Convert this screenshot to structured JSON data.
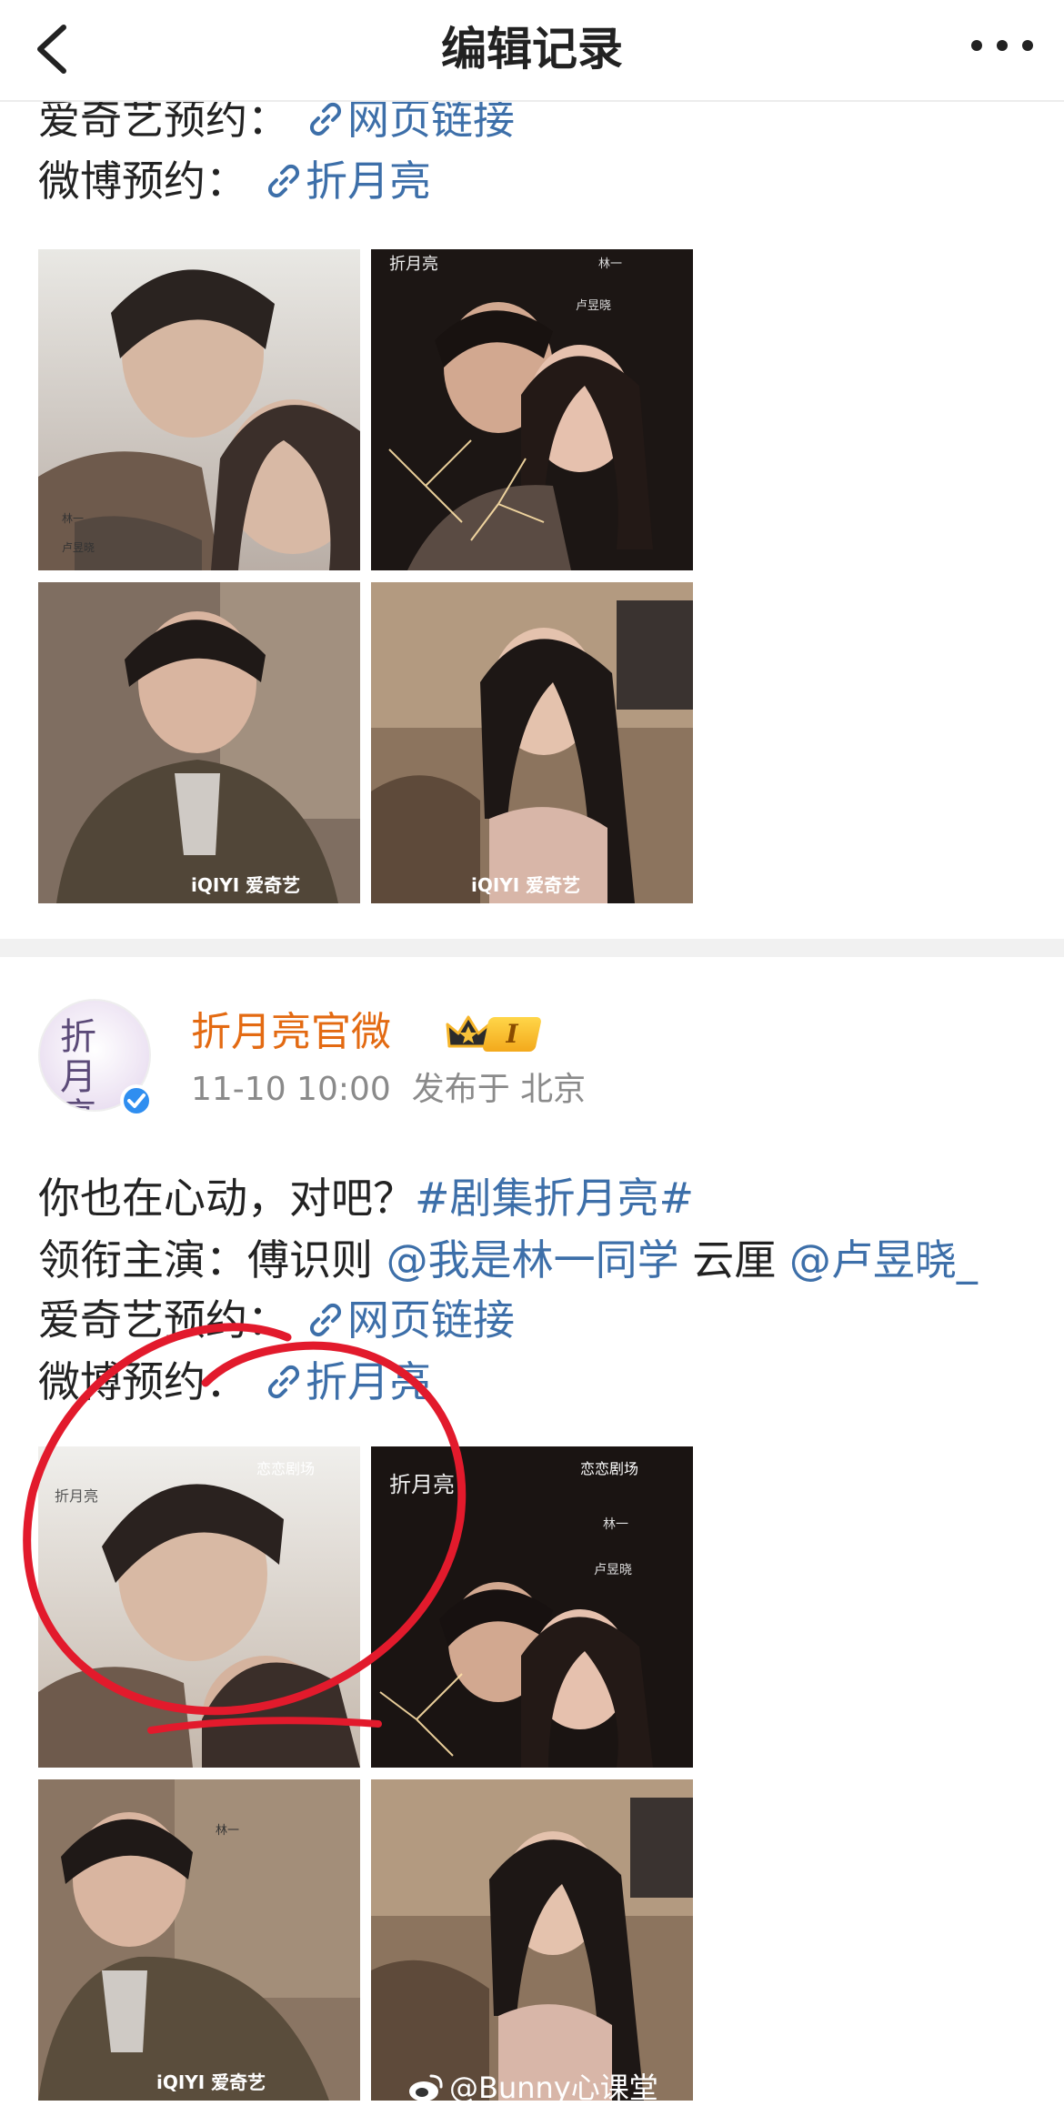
{
  "nav": {
    "title": "编辑记录",
    "back_icon": "chevron-left-icon",
    "more_icon": "more-dots-icon"
  },
  "post_prev": {
    "iqiyi_label": "爱奇艺预约：",
    "iqiyi_link": "网页链接",
    "weibo_label": "微博预约：",
    "weibo_link": "折月亮"
  },
  "post_main": {
    "author": "折月亮官微",
    "avatar_text": "折月亮",
    "vip_level": "I",
    "time": "11-10 10:00",
    "location": "发布于 北京",
    "line1_text": "你也在心动，对吧？",
    "line1_tag": "#剧集折月亮#",
    "line2_label": "领衔主演：傅识则 ",
    "line2_mention1": "@我是林一同学",
    "line2_mid": " 云厘 ",
    "line2_mention2": "@卢昱晓_",
    "iqiyi_label": "爱奇艺预约：",
    "iqiyi_link": "网页链接",
    "weibo_label": "微博预约：",
    "weibo_link": "折月亮"
  },
  "image_overlays": {
    "iqiyi": "iQIYI 爱奇艺",
    "brand": "恋恋剧场",
    "actor1": "林一",
    "actor2": "卢昱晓",
    "title": "折月亮"
  },
  "watermark": "@Bunny心课堂",
  "colors": {
    "link_blue": "#3d6fa9",
    "author_orange": "#e36a12",
    "annotation_red": "#e21a2c",
    "verified_blue": "#2f8ef0"
  }
}
